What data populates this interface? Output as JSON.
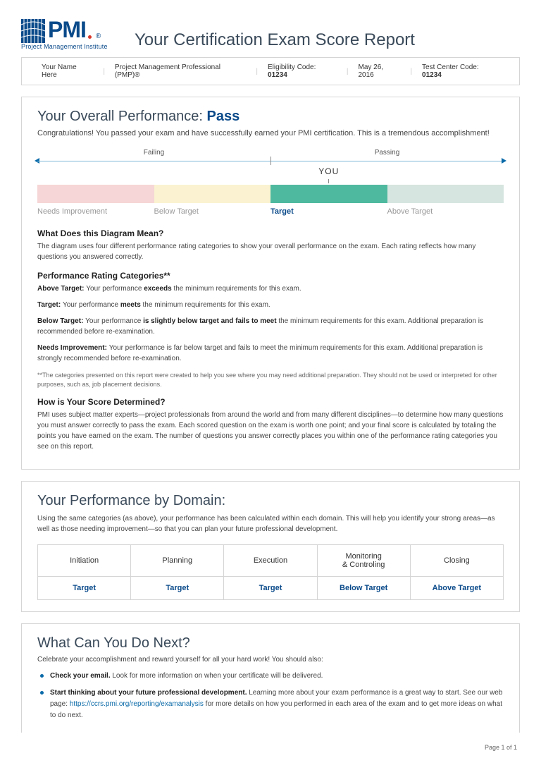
{
  "header": {
    "logo_text": "PMI",
    "logo_sub": "Project Management Institute",
    "title": "Your Certification Exam Score Report"
  },
  "info": {
    "name": "Your Name Here",
    "cert": "Project Management Professional (PMP)®",
    "elig_label": "Eligibility Code: ",
    "elig_code": "01234",
    "date": "May 26, 2016",
    "center_label": "Test Center Code: ",
    "center_code": "01234"
  },
  "overall": {
    "heading": "Your Overall Performance: ",
    "result": "Pass",
    "congrats": "Congratulations! You passed your exam and have successfully earned your PMI certification. This is a tremendous accomplishment!",
    "fail_label": "Failing",
    "pass_label": "Passing",
    "you_label": "YOU",
    "cats": [
      "Needs Improvement",
      "Below Target",
      "Target",
      "Above Target"
    ],
    "active_index": 2
  },
  "diagram": {
    "head": "What Does this Diagram Mean?",
    "body": "The diagram uses four different performance rating categories to show your overall performance on the exam. Each rating reflects how many questions you answered correctly."
  },
  "ratings": {
    "head": "Performance Rating Categories**",
    "above_b": "Above Target: ",
    "above_t1": "Your performance ",
    "above_em": "exceeds",
    "above_t2": " the minimum requirements for this exam.",
    "target_b": "Target: ",
    "target_t1": "Your performance ",
    "target_em": "meets",
    "target_t2": " the minimum requirements for this exam.",
    "below_b": "Below Target: ",
    "below_t1": "Your performance ",
    "below_em": "is slightly below target and fails to meet",
    "below_t2": " the minimum requirements for this exam. Additional preparation is recommended before re-examination.",
    "needs_b": "Needs Improvement: ",
    "needs_t": "Your performance is far below target and fails to meet the minimum requirements for this exam. Additional preparation is strongly recommended before re-examination.",
    "disclaimer": "**The categories presented on this report were created to help you see where you may need additional preparation. They should not be used or interpreted for other purposes, such as, job placement decisions."
  },
  "score_det": {
    "head": "How is Your Score Determined?",
    "body": "PMI uses subject matter experts—project professionals from around the world and from many different disciplines—to determine how many questions you must answer correctly to pass the exam. Each scored question on the exam is worth one point; and your final score is calculated by totaling the points you have earned on the exam. The number of questions you answer correctly places you within one of the performance rating categories you see on this report."
  },
  "domains": {
    "head": "Your Performance by Domain:",
    "intro": "Using the same categories (as above), your performance has been calculated within each domain. This will help you identify your strong areas—as well as those needing improvement—so that you can plan your future professional development.",
    "cols": [
      "Initiation",
      "Planning",
      "Execution",
      "Monitoring & Controling",
      "Closing"
    ],
    "vals": [
      "Target",
      "Target",
      "Target",
      "Below Target",
      "Above Target"
    ]
  },
  "next": {
    "head": "What Can You Do Next?",
    "intro": "Celebrate your accomplishment and reward yourself for all your hard work! You should also:",
    "b1_bold": "Check your email.",
    "b1_rest": " Look for more information on when your certificate will be delivered.",
    "b2_bold": "Start thinking about your future professional development.",
    "b2_rest1": " Learning more about your exam performance is a great way to start. See our web page: ",
    "b2_link": "https://ccrs.pmi.org/reporting/examanalysis",
    "b2_rest2": " for more details on how you performed in each area of the exam and to get more ideas on what to do next."
  },
  "footer": "Page 1 of 1"
}
